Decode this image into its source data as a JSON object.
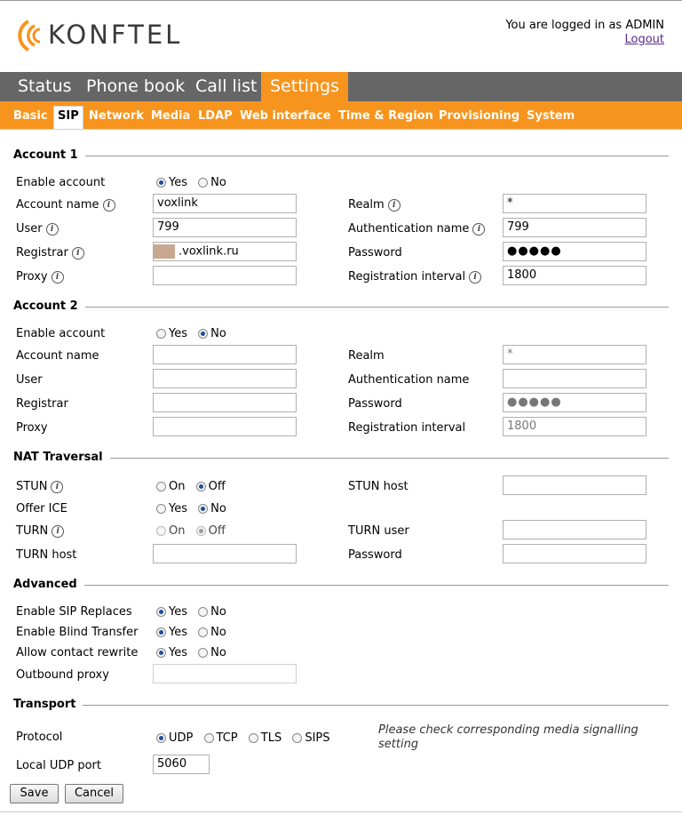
{
  "brand": "KONFTEL",
  "login": {
    "text": "You are logged in as ADMIN",
    "logout": "Logout"
  },
  "nav": {
    "tabs": [
      "Status",
      "Phone book",
      "Call list",
      "Settings"
    ],
    "active": "Settings"
  },
  "subnav": {
    "items": [
      "Basic",
      "SIP",
      "Network",
      "Media",
      "LDAP",
      "Web interface",
      "Time & Region",
      "Provisioning",
      "System"
    ],
    "active": "SIP"
  },
  "account1": {
    "title": "Account 1",
    "enable_label": "Enable account",
    "yes": "Yes",
    "no": "No",
    "account_name_label": "Account name",
    "account_name": "voxlink",
    "user_label": "User",
    "user": "799",
    "registrar_label": "Registrar",
    "registrar": ".voxlink.ru",
    "proxy_label": "Proxy",
    "proxy": "",
    "realm_label": "Realm",
    "realm": "*",
    "auth_label": "Authentication name",
    "auth": "799",
    "password_label": "Password",
    "password": "●●●●●",
    "interval_label": "Registration interval",
    "interval": "1800"
  },
  "account2": {
    "title": "Account 2",
    "enable_label": "Enable account",
    "yes": "Yes",
    "no": "No",
    "account_name_label": "Account name",
    "user_label": "User",
    "registrar_label": "Registrar",
    "proxy_label": "Proxy",
    "realm_label": "Realm",
    "realm": "*",
    "auth_label": "Authentication name",
    "password_label": "Password",
    "password": "●●●●●",
    "interval_label": "Registration interval",
    "interval": "1800"
  },
  "nat": {
    "title": "NAT Traversal",
    "stun_label": "STUN",
    "on": "On",
    "off": "Off",
    "stun_host_label": "STUN host",
    "ice_label": "Offer ICE",
    "yes": "Yes",
    "no": "No",
    "turn_label": "TURN",
    "turn_user_label": "TURN user",
    "turn_host_label": "TURN host",
    "password_label": "Password"
  },
  "advanced": {
    "title": "Advanced",
    "replaces_label": "Enable SIP Replaces",
    "blind_label": "Enable Blind Transfer",
    "contact_label": "Allow contact rewrite",
    "outbound_label": "Outbound proxy",
    "yes": "Yes",
    "no": "No"
  },
  "transport": {
    "title": "Transport",
    "protocol_label": "Protocol",
    "protocols": [
      "UDP",
      "TCP",
      "TLS",
      "SIPS"
    ],
    "selected": "UDP",
    "note": "Please check corresponding media signalling setting",
    "port_label": "Local UDP port",
    "port": "5060"
  },
  "buttons": {
    "save": "Save",
    "cancel": "Cancel"
  },
  "colors": {
    "accent": "#f7941d",
    "nav_bg": "#666666"
  }
}
